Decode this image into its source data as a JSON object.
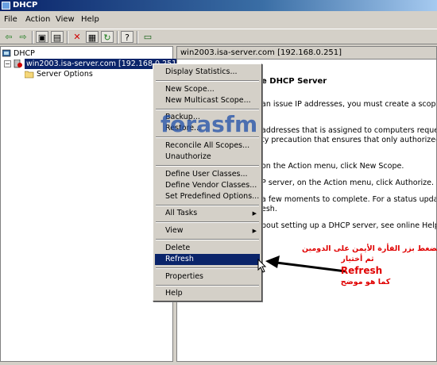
{
  "window": {
    "title": "DHCP"
  },
  "menu": {
    "file": "File",
    "action": "Action",
    "view": "View",
    "help": "Help"
  },
  "toolbar": {
    "icons": [
      "back-arrow-icon",
      "forward-arrow-icon",
      "up-folder-icon",
      "show-tree-icon",
      "delete-x-icon",
      "properties-icon",
      "refresh-icon",
      "help-icon",
      "console-icon"
    ]
  },
  "tree": {
    "root": "DHCP",
    "server": "win2003.isa-server.com [192.168.0.251]",
    "server_options": "Server Options"
  },
  "right_pane": {
    "header": "win2003.isa-server.com [192.168.0.251]",
    "heading": "e DHCP Server",
    "lines": [
      "an issue IP addresses, you must create a scope and au",
      "addresses that is assigned to computers requesting a c",
      "ty precaution that ensures that only authorized DHCP s",
      "on the Action menu, click New Scope.",
      "P server, on the Action menu, click Authorize.",
      "a few moments to complete. For a status update, eithe",
      "esh.",
      "bout setting up a DHCP server, see online Help."
    ]
  },
  "context_menu": {
    "items": [
      "Display Statistics...",
      "New Scope...",
      "New Multicast Scope...",
      "Backup...",
      "Restore...",
      "Reconcile All Scopes...",
      "Unauthorize",
      "Define User Classes...",
      "Define Vendor Classes...",
      "Set Predefined Options...",
      "All Tasks",
      "View",
      "Delete",
      "Refresh",
      "Properties",
      "Help"
    ],
    "highlighted": "Refresh"
  },
  "watermark": "forasfm",
  "annotation": {
    "line1": "بالضغط بزر الفأرة الأيمن على الدومين",
    "line2": "ثم أختيار",
    "line3": "Refresh",
    "line4": "كما هو موضح"
  },
  "colors": {
    "selection": "#0a246a",
    "annotation": "#e00000",
    "watermark": "#1f4fa8"
  }
}
